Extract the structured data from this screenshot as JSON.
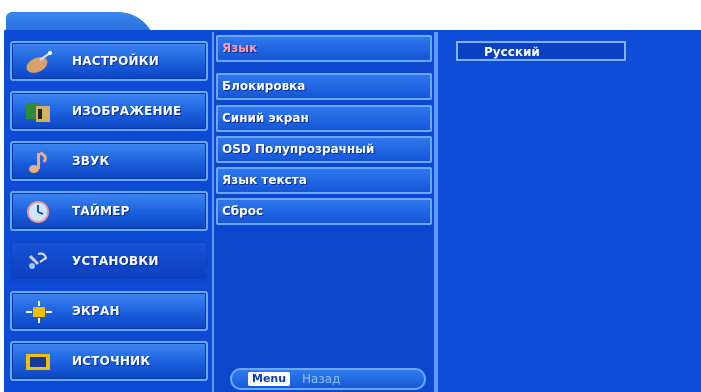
{
  "categories": [
    {
      "label": "НАСТРОЙКИ",
      "icon": "satellite-dish-icon"
    },
    {
      "label": "ИЗОБРАЖЕНИЕ",
      "icon": "picture-icon"
    },
    {
      "label": "ЗВУК",
      "icon": "music-note-icon"
    },
    {
      "label": "ТАЙМЕР",
      "icon": "clock-icon"
    },
    {
      "label": "УСТАНОВКИ",
      "icon": "settings-tools-icon"
    },
    {
      "label": "ЭКРАН",
      "icon": "screen-arrows-icon"
    },
    {
      "label": "ИСТОЧНИК",
      "icon": "source-icon"
    }
  ],
  "active_category": "УСТАНОВКИ",
  "submenu": {
    "items": [
      "Язык",
      "Блокировка",
      "Синий  экран",
      "OSD Полупрозрачный",
      "Язык  текста",
      "Сброс"
    ],
    "selected": "Язык"
  },
  "footer": {
    "key_label": "Menu",
    "back_label": "Назад"
  },
  "value_panel": {
    "value": "Русский"
  },
  "colors": {
    "panel_blue": "#0e4bd4",
    "highlight_text": "#ff9fb4",
    "border_light": "#6aa8ff"
  }
}
